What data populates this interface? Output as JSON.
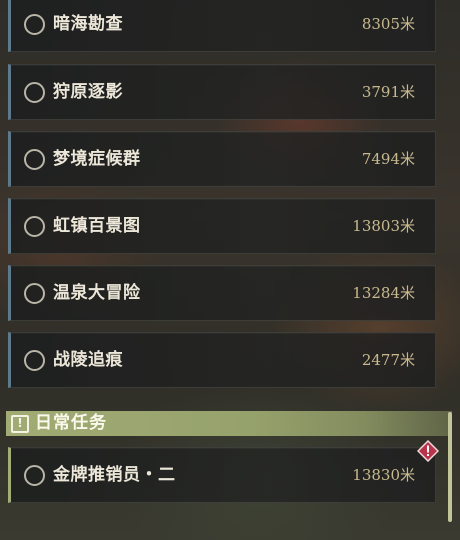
{
  "quests": [
    {
      "name": "暗海勘查",
      "distance": "8305米"
    },
    {
      "name": "狩原逐影",
      "distance": "3791米"
    },
    {
      "name": "梦境症候群",
      "distance": "7494米"
    },
    {
      "name": "虹镇百景图",
      "distance": "13803米"
    },
    {
      "name": "温泉大冒险",
      "distance": "13284米"
    },
    {
      "name": "战陵追痕",
      "distance": "2477米"
    }
  ],
  "daily_section": {
    "title": "日常任务",
    "icon": "exclamation-square-icon",
    "accent_color": "#a1ab74"
  },
  "daily_quests": [
    {
      "name": "金牌推销员・二",
      "distance": "13830米",
      "badge_icon": "alert-diamond-icon",
      "badge_color": "#b8344a"
    }
  ],
  "colors": {
    "quest_accent": "#5c7a8c",
    "distance_text": "#c9b98f",
    "name_text": "#ece7d9"
  }
}
